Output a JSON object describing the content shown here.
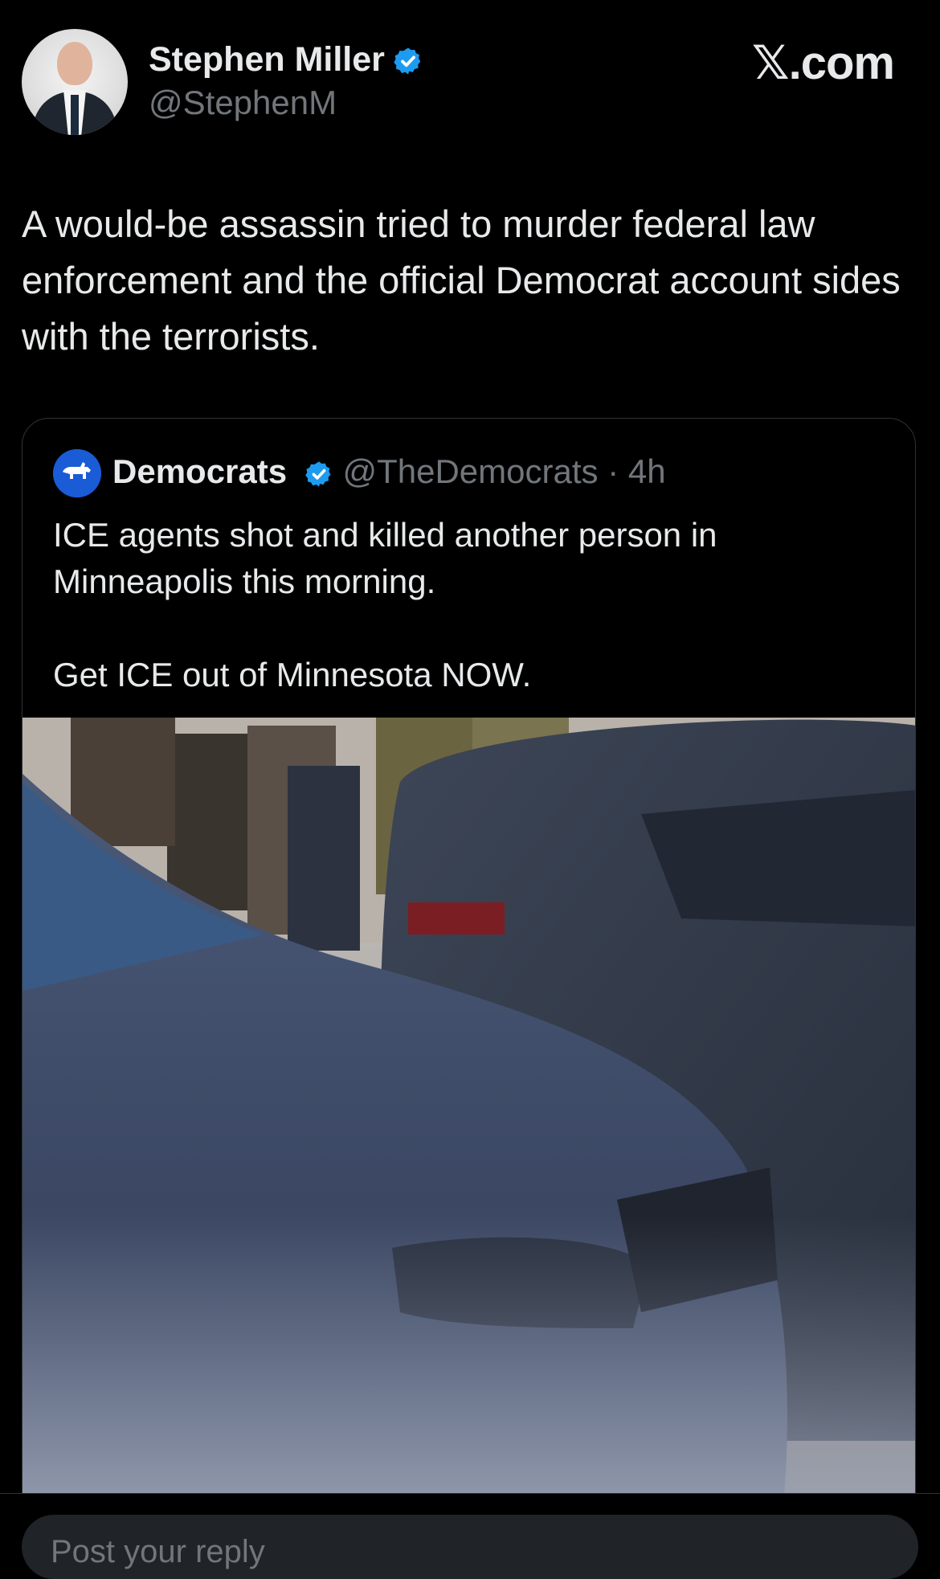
{
  "brand": {
    "label": "𝕏.com"
  },
  "author": {
    "name": "Stephen Miller",
    "handle": "@StephenM",
    "verified": true
  },
  "tweet": {
    "text": "A would-be assassin tried to murder federal law enforcement and the official Democrat account sides with the terrorists."
  },
  "quoted_tweet": {
    "name": "Democrats",
    "handle": "@TheDemocrats",
    "separator": "·",
    "time": "4h",
    "verified": true,
    "text_line1": "ICE agents shot and killed another person in Minneapolis this morning.",
    "text_line2": "Get ICE out of Minnesota NOW."
  },
  "reply": {
    "placeholder": "Post your reply"
  },
  "colors": {
    "background": "#000000",
    "text_primary": "#e7e9ea",
    "text_secondary": "#71767b",
    "verified_blue": "#1d9bf0",
    "border": "#2f3336"
  }
}
